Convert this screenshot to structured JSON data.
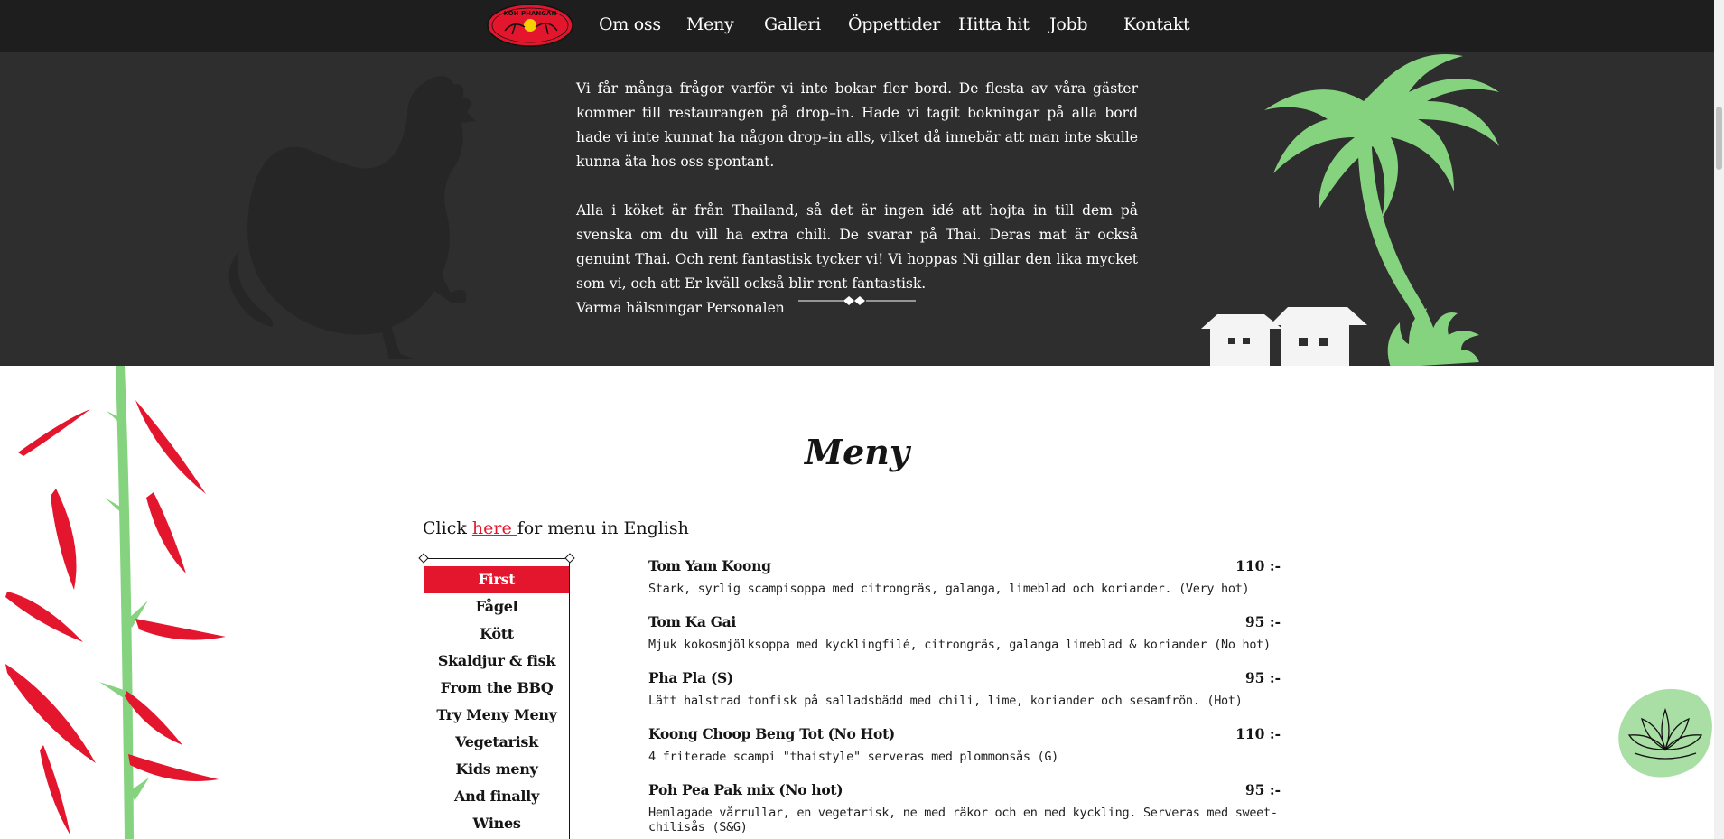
{
  "nav": {
    "logo_text": "KOH PHANGAN",
    "items": [
      {
        "label": "Om oss",
        "active": true
      },
      {
        "label": "Meny",
        "active": false
      },
      {
        "label": "Galleri",
        "active": false
      },
      {
        "label": "Öppettider",
        "active": false
      },
      {
        "label": "Hitta hit",
        "active": false
      },
      {
        "label": "Jobb",
        "active": false
      },
      {
        "label": "Kontakt",
        "active": false
      }
    ]
  },
  "about": {
    "paragraph_1": "Vi får många frågor varför vi inte bokar fler bord. De flesta av våra gäster kommer till restaurangen på drop–in. Hade vi tagit bokningar på alla bord hade vi inte kunnat ha någon drop–in alls, vilket då innebär att man inte skulle kunna äta hos oss spontant.",
    "paragraph_2": "Alla i köket är från Thailand, så det är ingen idé att hojta in till dem på svenska om du vill ha extra chili. De svarar på Thai. Deras mat är också genuint Thai. Och rent fantastisk tycker vi! Vi hoppas Ni gillar den lika mycket som vi, och att Er kväll också blir rent fantastisk.",
    "signature": "Varma hälsningar Personalen"
  },
  "menu": {
    "title": "Meny",
    "english_prefix": "Click ",
    "english_link": "here ",
    "english_suffix": "for menu in English",
    "categories": [
      {
        "label": "First",
        "active": true
      },
      {
        "label": "Fågel",
        "active": false
      },
      {
        "label": "Kött",
        "active": false
      },
      {
        "label": "Skaldjur & fisk",
        "active": false
      },
      {
        "label": "From the BBQ",
        "active": false
      },
      {
        "label": "Try Meny Meny",
        "active": false
      },
      {
        "label": "Vegetarisk",
        "active": false
      },
      {
        "label": "Kids meny",
        "active": false
      },
      {
        "label": "And finally",
        "active": false
      },
      {
        "label": "Wines",
        "active": false
      }
    ],
    "dishes": [
      {
        "name": "Tom Yam Koong",
        "price": "110 :-",
        "description": "Stark, syrlig scampisoppa med citrongräs, galanga, limeblad och koriander. (Very hot)"
      },
      {
        "name": "Tom Ka Gai",
        "price": "95 :-",
        "description": "Mjuk kokosmjölksoppa med kycklingfilé, citrongräs, galanga limeblad & koriander (No hot)"
      },
      {
        "name": "Pha Pla (S)",
        "price": "95 :-",
        "description": "Lätt halstrad tonfisk på salladsbädd med chili, lime, koriander och sesamfrön. (Hot)"
      },
      {
        "name": "Koong Choop Beng Tot (No Hot)",
        "price": "110 :-",
        "description": "4 friterade scampi \"thaistyle\" serveras med plommonsås (G)"
      },
      {
        "name": "Poh Pea Pak mix (No hot)",
        "price": "95 :-",
        "description": "Hemlagade vårrullar, en vegetarisk, ne med räkor och en med kyckling. Serveras med sweet-chilisås (S&G)"
      }
    ]
  },
  "colors": {
    "accent": "#e4162e",
    "nav_bg": "#1e1e1e",
    "section_dark": "#2e2e2e",
    "palm_green": "#86d37f"
  }
}
